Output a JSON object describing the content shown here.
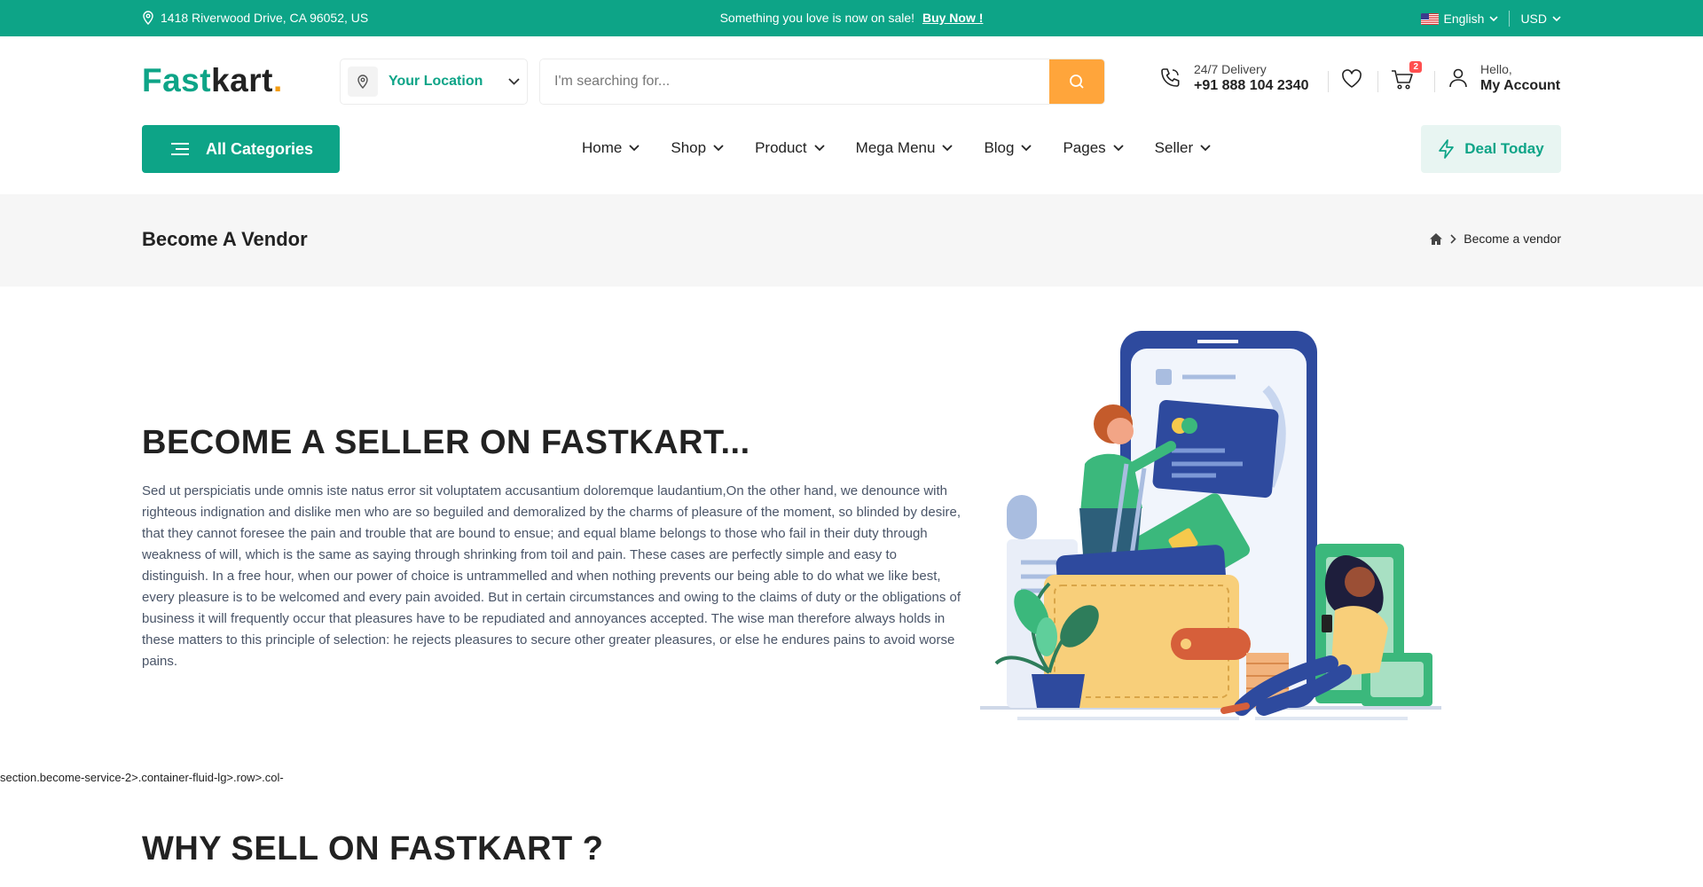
{
  "topbar": {
    "address": "1418 Riverwood Drive, CA 96052, US",
    "promo_text": "Something you love is now on sale!",
    "promo_link": "Buy Now !",
    "language": "English",
    "currency": "USD",
    "background": "#0da487"
  },
  "header": {
    "logo_main": "Fast",
    "logo_rest": "kart",
    "logo_dot": ".",
    "location_label": "Your Location",
    "search_placeholder": "I'm searching for...",
    "delivery_label": "24/7 Delivery",
    "delivery_phone": "+91 888 104 2340",
    "cart_count": "2",
    "account_greeting": "Hello,",
    "account_label": "My Account"
  },
  "nav": {
    "all_categories": "All Categories",
    "items": [
      "Home",
      "Shop",
      "Product",
      "Mega Menu",
      "Blog",
      "Pages",
      "Seller"
    ],
    "deal_today": "Deal Today"
  },
  "breadcrumb": {
    "page_title": "Become A Vendor",
    "current": "Become a vendor"
  },
  "hero": {
    "title": "BECOME A SELLER ON FASTKART...",
    "body": "Sed ut perspiciatis unde omnis iste natus error sit voluptatem accusantium doloremque laudantium,On the other hand, we denounce with righteous indignation and dislike men who are so beguiled and demoralized by the charms of pleasure of the moment, so blinded by desire, that they cannot foresee the pain and trouble that are bound to ensue; and equal blame belongs to those who fail in their duty through weakness of will, which is the same as saying through shrinking from toil and pain. These cases are perfectly simple and easy to distinguish. In a free hour, when our power of choice is untrammelled and when nothing prevents our being able to do what we like best, every pleasure is to be welcomed and every pain avoided. But in certain circumstances and owing to the claims of duty or the obligations of business it will frequently occur that pleasures have to be repudiated and annoyances accepted. The wise man therefore always holds in these matters to this principle of selection: he rejects pleasures to secure other greater pleasures, or else he endures pains to avoid worse pains."
  },
  "dev_path": "section.become-service-2>.container-fluid-lg>.row>.col-",
  "why": {
    "title": "WHY SELL ON FASTKART ?"
  },
  "colors": {
    "brand": "#0da487",
    "search_button": "#ffa53b",
    "badge": "#ff4f4f"
  },
  "icons": [
    "location-pin-icon",
    "search-icon",
    "phone-icon",
    "heart-icon",
    "cart-icon",
    "user-icon",
    "menu-lines-icon",
    "lightning-icon",
    "home-icon",
    "chevron-down-icon",
    "chevron-right-icon",
    "us-flag-icon"
  ]
}
